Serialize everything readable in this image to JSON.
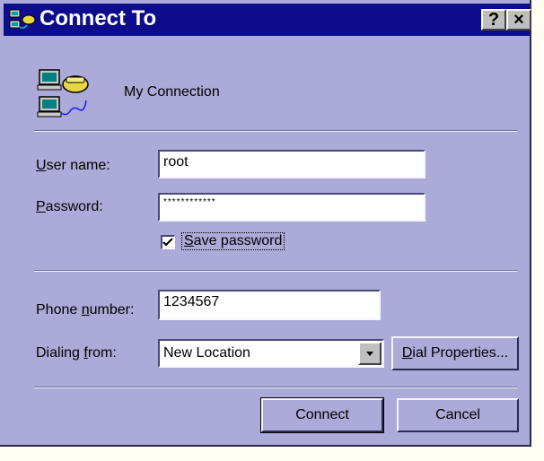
{
  "window": {
    "title": "Connect To",
    "help_label": "?",
    "close_label": "×"
  },
  "connection": {
    "name": "My Connection"
  },
  "form": {
    "username_label_prefix": "U",
    "username_label_rest": "ser name:",
    "username_value": "root",
    "password_label_prefix": "P",
    "password_label_rest": "assword:",
    "password_value": "************",
    "save_password_prefix": "S",
    "save_password_rest": "ave password",
    "save_password_checked": true,
    "phone_label_start": "Phone ",
    "phone_label_u": "n",
    "phone_label_rest": "umber:",
    "phone_value": "1234567",
    "dialing_label_start": "Dialing ",
    "dialing_label_u": "f",
    "dialing_label_rest": "rom:",
    "dialing_value": "New Location",
    "dial_props_prefix": "D",
    "dial_props_rest": "ial Properties..."
  },
  "buttons": {
    "connect": "Connect",
    "cancel": "Cancel"
  }
}
